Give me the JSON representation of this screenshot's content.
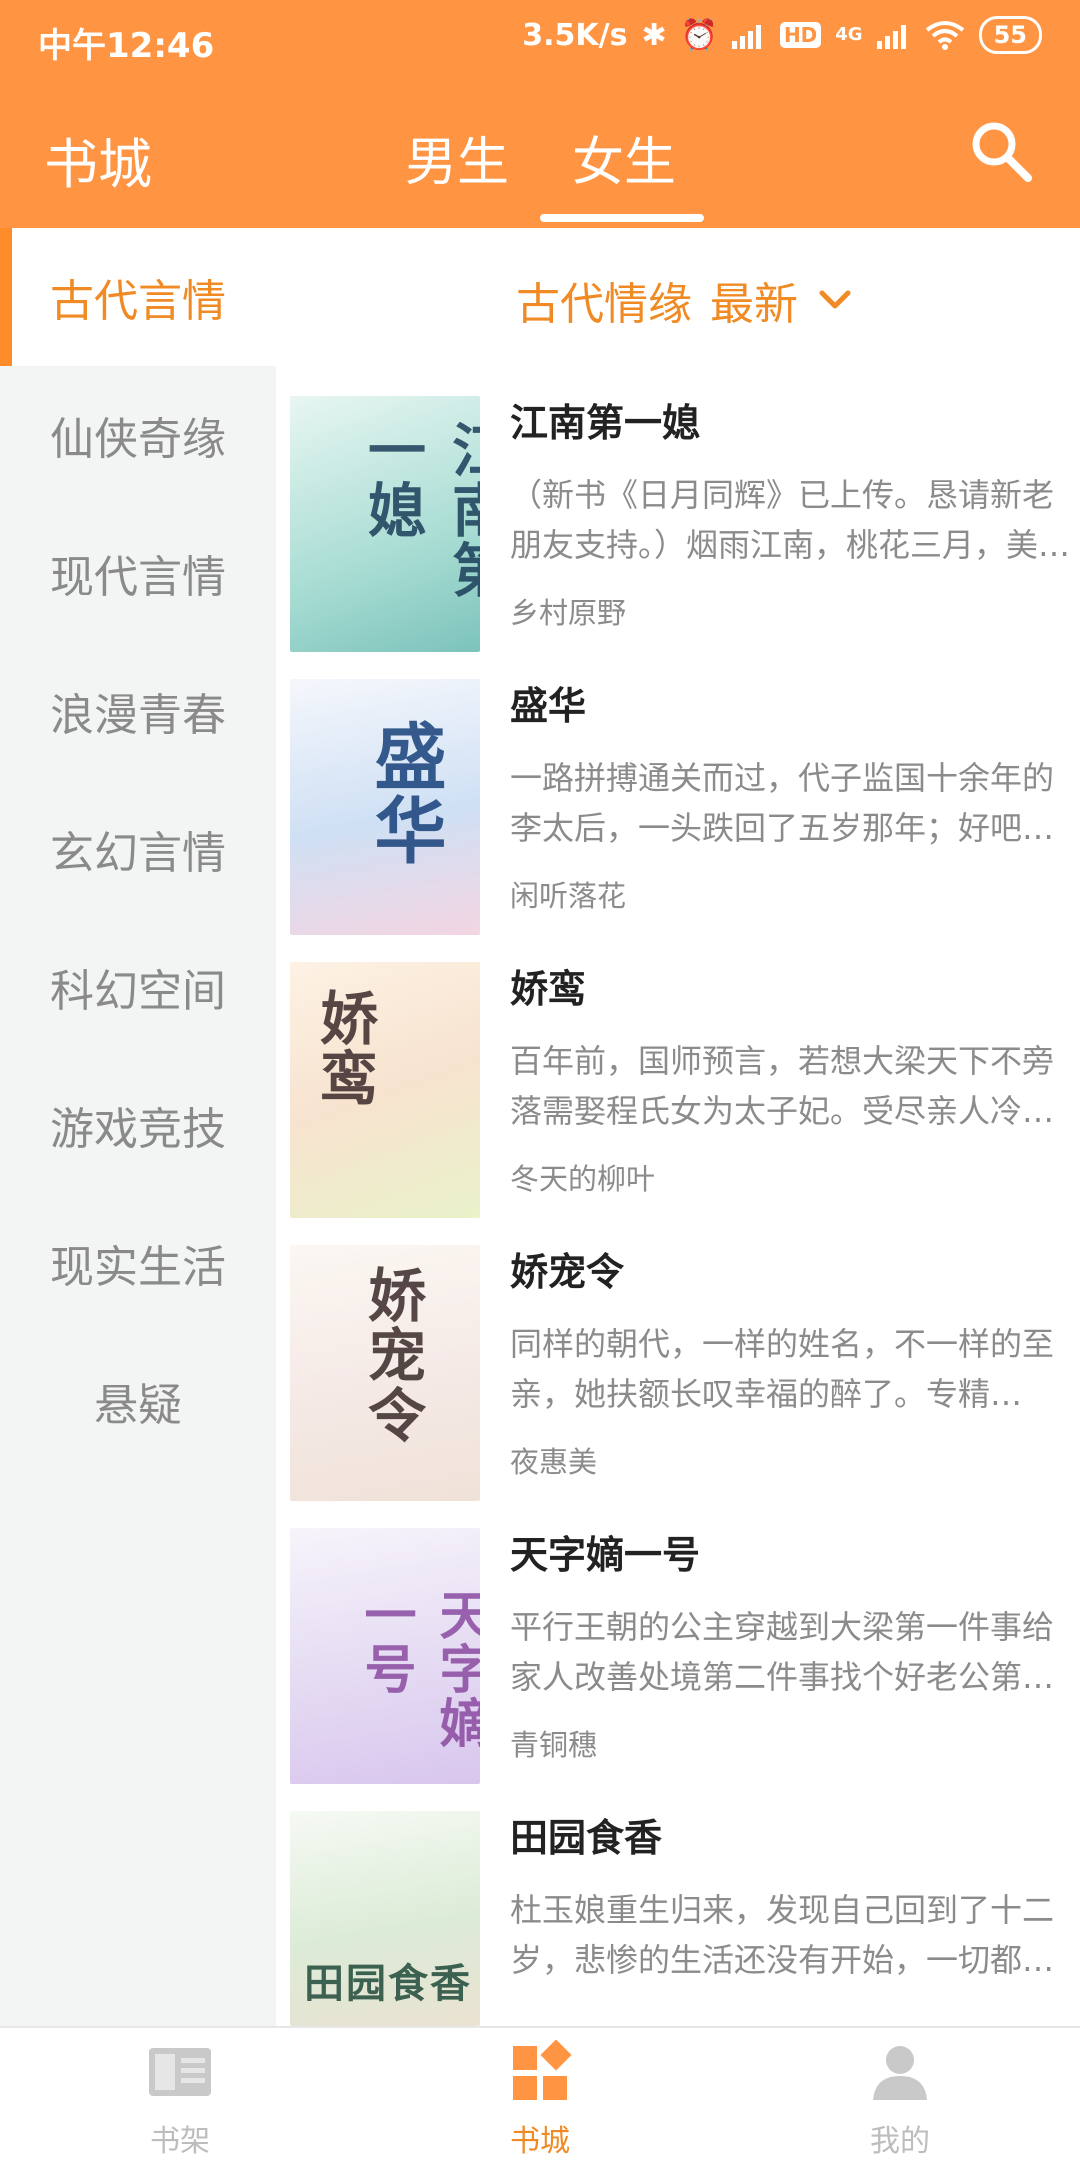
{
  "status_bar": {
    "time": "中午12:46",
    "net_speed": "3.5K/s",
    "hd_label": "HD",
    "net_type": "4G",
    "battery": "55"
  },
  "header": {
    "title": "书城",
    "tabs": [
      {
        "label": "男生",
        "active": false
      },
      {
        "label": "女生",
        "active": true
      }
    ]
  },
  "sidebar": {
    "items": [
      {
        "label": "古代言情",
        "active": true
      },
      {
        "label": "仙侠奇缘"
      },
      {
        "label": "现代言情"
      },
      {
        "label": "浪漫青春"
      },
      {
        "label": "玄幻言情"
      },
      {
        "label": "科幻空间"
      },
      {
        "label": "游戏竞技"
      },
      {
        "label": "现实生活"
      },
      {
        "label": "悬疑"
      }
    ]
  },
  "filter": {
    "category": "古代情缘",
    "sort": "最新"
  },
  "books": [
    {
      "title": "江南第一媳",
      "desc": "（新书《日月同辉》已上传。恳请新老朋友支持。）烟雨江南，桃花三月，美人如玉，才子风流……",
      "author": "乡村原野",
      "cover_text": "江南第一媳"
    },
    {
      "title": "盛华",
      "desc": "一路拼搏通关而过，代子监国十余年的李太后，一头跌回了五岁那年；好吧，重新来过……",
      "author": "闲听落花",
      "cover_text": "盛华"
    },
    {
      "title": "娇鸾",
      "desc": "百年前，国师预言，若想大梁天下不旁落需娶程氏女为太子妃。受尽亲人冷落……",
      "author": "冬天的柳叶",
      "cover_text": "娇鸾"
    },
    {
      "title": "娇宠令",
      "desc": "同样的朝代，一样的姓名，不一样的至亲，她扶额长叹幸福的醉了。专精型……",
      "author": "夜惠美",
      "cover_text": "娇宠令"
    },
    {
      "title": "天字嫡一号",
      "desc": "平行王朝的公主穿越到大梁第一件事给家人改善处境第二件事找个好老公第三件……",
      "author": "青铜穗",
      "cover_text": "天字嫡一号"
    },
    {
      "title": "田园食香",
      "desc": "杜玉娘重生归来，发现自己回到了十二岁，悲惨的生活还没有开始，一切都来得及……",
      "author": "",
      "cover_text": "田园食香"
    }
  ],
  "bottom_nav": [
    {
      "label": "书架",
      "icon": "bookshelf-icon",
      "active": false
    },
    {
      "label": "书城",
      "icon": "bookstore-icon",
      "active": true
    },
    {
      "label": "我的",
      "icon": "profile-icon",
      "active": false
    }
  ],
  "colors": {
    "accent": "#FF9442",
    "active_text": "#F08A24",
    "sidebar_bg": "#F3F4F4"
  }
}
